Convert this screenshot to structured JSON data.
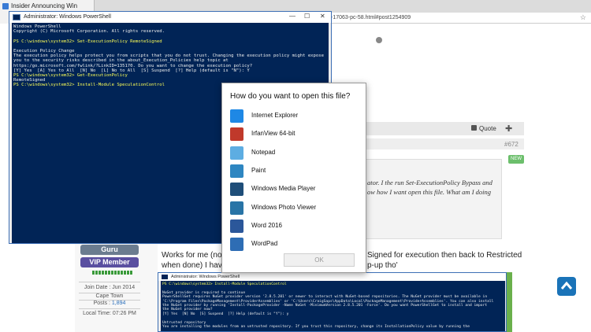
{
  "browser": {
    "tab_title": "Insider Announcing Win",
    "url_fragment": "-17063-pc-58.html#post1254909"
  },
  "forum": {
    "quote_label": "Quote",
    "post_number": "#672",
    "new_badge": "NEW",
    "quote_text_line1": "ator. I the run Set-ExecutionPolicy Bypass and",
    "quote_text_line2": "ow how I want open this file. What am I doing",
    "reply_line1": "Works for me (note",
    "reply_line1_end": "Signed for execution then back to Restricted",
    "reply_line2": "when done) I have",
    "reply_line2_end": "p-up tho'"
  },
  "user": {
    "rank1": "Guru",
    "rank2": "VIP Member",
    "join_date": "Join Date : Jun 2014",
    "location": "Cape Town",
    "posts_label": "Posts : ",
    "posts_value": "1,894",
    "local_time": "Local Time: 07:26 PM"
  },
  "ps1": {
    "title": "Administrator: Windows PowerShell",
    "lines": [
      {
        "text": "Windows PowerShell",
        "cls": ""
      },
      {
        "text": "Copyright (C) Microsoft Corporation. All rights reserved.",
        "cls": ""
      },
      {
        "text": "",
        "cls": ""
      },
      {
        "text": "PS C:\\windows\\system32> Set-ExecutionPolicy RemoteSigned",
        "cls": "yellow"
      },
      {
        "text": "",
        "cls": ""
      },
      {
        "text": "Execution Policy Change",
        "cls": ""
      },
      {
        "text": "The execution policy helps protect you from scripts that you do not trust. Changing the execution policy might expose",
        "cls": ""
      },
      {
        "text": "you to the security risks described in the about_Execution_Policies help topic at",
        "cls": ""
      },
      {
        "text": "https:/go.microsoft.com/fwlink/?LinkID=135170. Do you want to change the execution policy?",
        "cls": ""
      },
      {
        "text": "[Y] Yes  [A] Yes to All  [N] No  [L] No to All  [S] Suspend  [?] Help (default is \"N\"): Y",
        "cls": ""
      },
      {
        "text": "PS C:\\windows\\system32> Get-ExecutionPolicy",
        "cls": "yellow"
      },
      {
        "text": "RemoteSigned",
        "cls": ""
      },
      {
        "text": "PS C:\\windows\\system32> Install-Module SpeculationControl",
        "cls": "yellow"
      }
    ]
  },
  "ps2": {
    "title": "Administrator: Windows PowerShell",
    "lines": [
      {
        "text": "PS C:\\windows\\system32> Install-Module SpeculationControl",
        "cls": "yellow"
      },
      {
        "text": "",
        "cls": ""
      },
      {
        "text": "NuGet provider is required to continue",
        "cls": ""
      },
      {
        "text": "PowerShellGet requires NuGet provider version '2.8.5.201' or newer to interact with NuGet-based repositories. The NuGet provider must be available in",
        "cls": ""
      },
      {
        "text": "'C:\\Program Files\\PackageManagement\\ProviderAssemblies' or 'C:\\Users\\CraigSaps\\AppData\\Local\\PackageManagement\\ProviderAssemblies'. You can also install",
        "cls": ""
      },
      {
        "text": "the NuGet provider by running 'Install-PackageProvider -Name NuGet -MinimumVersion 2.8.5.201 -Force'. Do you want PowerShellGet to install and import",
        "cls": ""
      },
      {
        "text": "the NuGet provider now?",
        "cls": ""
      },
      {
        "text": "[Y] Yes  [N] No  [S] Suspend  [?] Help (default is \"Y\"): y",
        "cls": ""
      },
      {
        "text": "",
        "cls": ""
      },
      {
        "text": "Untrusted repository",
        "cls": ""
      },
      {
        "text": "You are installing the modules from an untrusted repository. If you trust this repository, change its InstallationPolicy value by running the",
        "cls": ""
      }
    ]
  },
  "dialog": {
    "title": "How do you want to open this file?",
    "apps": [
      {
        "label": "Internet Explorer",
        "icon": "internet-explorer-icon",
        "color": "#1e88e5"
      },
      {
        "label": "IrfanView 64-bit",
        "icon": "irfanview-icon",
        "color": "#c0392b"
      },
      {
        "label": "Notepad",
        "icon": "notepad-icon",
        "color": "#5dade2"
      },
      {
        "label": "Paint",
        "icon": "paint-icon",
        "color": "#2e86c1"
      },
      {
        "label": "Windows Media Player",
        "icon": "media-player-icon",
        "color": "#1f4e79"
      },
      {
        "label": "Windows Photo Viewer",
        "icon": "photo-viewer-icon",
        "color": "#2874a6"
      },
      {
        "label": "Word 2016",
        "icon": "word-icon",
        "color": "#2b579a"
      },
      {
        "label": "WordPad",
        "icon": "wordpad-icon",
        "color": "#2e6db4"
      }
    ],
    "ok_label": "OK"
  },
  "colors": {
    "console_bg": "#012456",
    "accent": "#1a73b8",
    "guru": "#6b7c8f",
    "vip": "#5a4fa0"
  }
}
